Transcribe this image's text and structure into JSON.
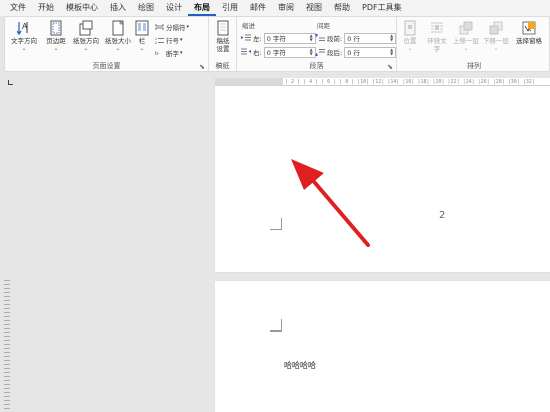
{
  "menu": {
    "tabs": [
      {
        "label": "文件"
      },
      {
        "label": "开始"
      },
      {
        "label": "模板中心"
      },
      {
        "label": "插入"
      },
      {
        "label": "绘图"
      },
      {
        "label": "设计"
      },
      {
        "label": "布局",
        "active": true
      },
      {
        "label": "引用"
      },
      {
        "label": "邮件"
      },
      {
        "label": "审阅"
      },
      {
        "label": "视图"
      },
      {
        "label": "帮助"
      },
      {
        "label": "PDF工具集"
      }
    ]
  },
  "ribbon": {
    "page_setup": {
      "label": "页面设置",
      "text_direction": "文字方向",
      "margins": "页边距",
      "orientation": "纸张方向",
      "size": "纸张大小",
      "columns": "栏",
      "breaks": "分隔符",
      "line_numbers": "行号",
      "hyphenation": "断字"
    },
    "draft": {
      "label": "稿纸",
      "button_line1": "稿纸",
      "button_line2": "设置"
    },
    "paragraph": {
      "label": "段落",
      "indent_head": "缩进",
      "spacing_head": "间距",
      "left_label": "左:",
      "left_value": "0 字符",
      "right_label": "右:",
      "right_value": "0 字符",
      "before_label": "段前:",
      "before_value": "0 行",
      "after_label": "段后:",
      "after_value": "0 行"
    },
    "arrange": {
      "label": "排列",
      "position": "位置",
      "wrap_text_1": "环绕文",
      "wrap_text_2": "字",
      "bring_forward": "上移一层",
      "send_backward": "下移一层",
      "selection_pane": "选择窗格"
    }
  },
  "ruler": {
    "marks": "| 2 |   | 4 |   | 6 |   | 8 |   |10|   |12|   |14|   |16|   |18|   |20|   |22|   |24|   |26|   |28|   |30|   |32|"
  },
  "document": {
    "page_number": "2",
    "body_text": "哈哈哈哈"
  },
  "colors": {
    "arrow": "#e02020",
    "accent": "#1f5fbf"
  }
}
